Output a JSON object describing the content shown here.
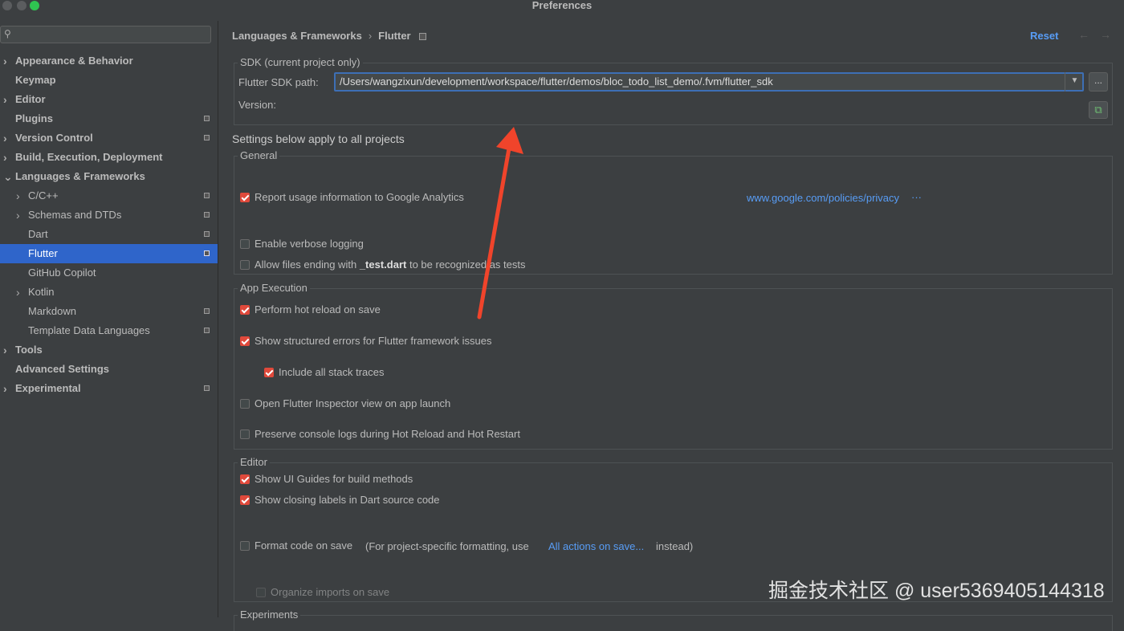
{
  "window": {
    "title": "Preferences"
  },
  "search": {
    "placeholder": ""
  },
  "sidebar": {
    "items": [
      {
        "label": "Appearance & Behavior",
        "expandable": true,
        "bold": true,
        "indent": 0,
        "project": false
      },
      {
        "label": "Keymap",
        "expandable": false,
        "bold": true,
        "indent": 0,
        "project": false
      },
      {
        "label": "Editor",
        "expandable": true,
        "bold": true,
        "indent": 0,
        "project": false
      },
      {
        "label": "Plugins",
        "expandable": false,
        "bold": true,
        "indent": 0,
        "project": true
      },
      {
        "label": "Version Control",
        "expandable": true,
        "bold": true,
        "indent": 0,
        "project": true
      },
      {
        "label": "Build, Execution, Deployment",
        "expandable": true,
        "bold": true,
        "indent": 0,
        "project": false
      },
      {
        "label": "Languages & Frameworks",
        "expandable": true,
        "expanded": true,
        "bold": true,
        "indent": 0,
        "project": false
      },
      {
        "label": "C/C++",
        "expandable": true,
        "bold": false,
        "indent": 1,
        "project": true
      },
      {
        "label": "Schemas and DTDs",
        "expandable": true,
        "bold": false,
        "indent": 1,
        "project": true
      },
      {
        "label": "Dart",
        "expandable": false,
        "bold": false,
        "indent": 1,
        "project": true
      },
      {
        "label": "Flutter",
        "expandable": false,
        "bold": false,
        "indent": 1,
        "project": true,
        "selected": true
      },
      {
        "label": "GitHub Copilot",
        "expandable": false,
        "bold": false,
        "indent": 1,
        "project": false
      },
      {
        "label": "Kotlin",
        "expandable": true,
        "bold": false,
        "indent": 1,
        "project": false
      },
      {
        "label": "Markdown",
        "expandable": false,
        "bold": false,
        "indent": 1,
        "project": true
      },
      {
        "label": "Template Data Languages",
        "expandable": false,
        "bold": false,
        "indent": 1,
        "project": true
      },
      {
        "label": "Tools",
        "expandable": true,
        "bold": true,
        "indent": 0,
        "project": false
      },
      {
        "label": "Advanced Settings",
        "expandable": false,
        "bold": true,
        "indent": 0,
        "project": false
      },
      {
        "label": "Experimental",
        "expandable": true,
        "bold": true,
        "indent": 0,
        "project": true
      }
    ]
  },
  "header": {
    "crumb1": "Languages & Frameworks",
    "crumb2": "Flutter",
    "reset": "Reset"
  },
  "sdk": {
    "group_title": "SDK (current project only)",
    "path_label": "Flutter SDK path:",
    "path_value": "/Users/wangzixun/development/workspace/flutter/demos/bloc_todo_list_demo/.fvm/flutter_sdk",
    "browse": "...",
    "version_label": "Version:"
  },
  "settings_heading": "Settings below apply to all projects",
  "general": {
    "title": "General",
    "analytics": {
      "label": "Report usage information to Google Analytics",
      "checked": true
    },
    "privacy_link": "www.google.com/policies/privacy",
    "privacy_more": "···",
    "verbose": {
      "label": "Enable verbose logging",
      "checked": false
    },
    "test_files": {
      "prefix": "Allow files ending with",
      "bold": "_test.dart",
      "suffix": "to be recognized as tests",
      "checked": false
    }
  },
  "app_execution": {
    "title": "App Execution",
    "hot_reload": {
      "label": "Perform hot reload on save",
      "checked": true
    },
    "structured_errors": {
      "label": "Show structured errors for Flutter framework issues",
      "checked": true
    },
    "stack_traces": {
      "label": "Include all stack traces",
      "checked": true
    },
    "inspector": {
      "label": "Open Flutter Inspector view on app launch",
      "checked": false
    },
    "preserve_logs": {
      "label": "Preserve console logs during Hot Reload and Hot Restart",
      "checked": false
    }
  },
  "editor": {
    "title": "Editor",
    "ui_guides": {
      "label": "Show UI Guides for build methods",
      "checked": true
    },
    "closing_labels": {
      "label": "Show closing labels in Dart source code",
      "checked": true
    },
    "format_on_save": {
      "label": "Format code on save",
      "checked": false
    },
    "format_hint_prefix": "(For project-specific formatting, use",
    "format_hint_link": "All actions on save...",
    "format_hint_suffix": "instead)",
    "organize_imports": {
      "label": "Organize imports on save",
      "checked": false
    }
  },
  "experiments": {
    "title": "Experiments"
  },
  "watermark": "掘金技术社区 @ user5369405144318",
  "colors": {
    "accent": "#2f65ca",
    "checkbox": "#e0493b",
    "link": "#589df6",
    "annotation": "#f0442b"
  }
}
